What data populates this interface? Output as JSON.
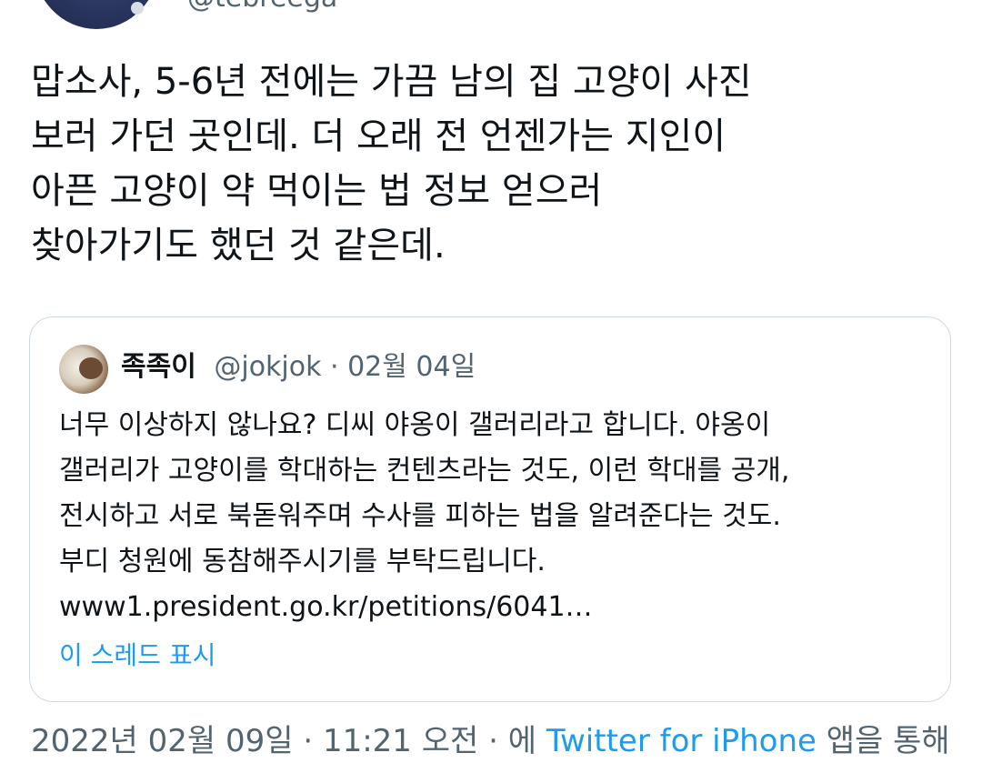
{
  "author": {
    "handle": "@tebreega"
  },
  "tweet": {
    "lines": [
      "맙소사, 5-6년 전에는 가끔 남의 집 고양이 사진",
      "보러 가던 곳인데. 더 오래 전 언젠가는 지인이",
      "아픈 고양이 약 먹이는 법 정보 얻으러",
      "찾아가기도 했던 것 같은데."
    ]
  },
  "quoted_tweet": {
    "name": "족족이",
    "handle": "@jokjok",
    "separator": " · ",
    "date": "02월 04일",
    "lines": [
      "너무 이상하지 않나요? 디씨 야옹이 갤러리라고 합니다. 야옹이",
      "갤러리가 고양이를 학대하는 컨텐츠라는 것도, 이런 학대를 공개,",
      "전시하고 서로 북돋워주며 수사를 피하는 법을 알려준다는 것도.",
      "부디 청원에 동참해주시기를 부탁드립니다.",
      "www1.president.go.kr/petitions/6041…"
    ],
    "show_thread": "이 스레드 표시"
  },
  "meta": {
    "date": "2022년 02월 09일",
    "separator": " · ",
    "time": "11:21 오전",
    "via_prefix": "에 ",
    "client": "Twitter for iPhone",
    "via_suffix": " 앱을 통해"
  },
  "colors": {
    "text": "#0f1419",
    "secondary": "#536471",
    "link": "#1d9bf0",
    "border": "#cfd9de"
  }
}
